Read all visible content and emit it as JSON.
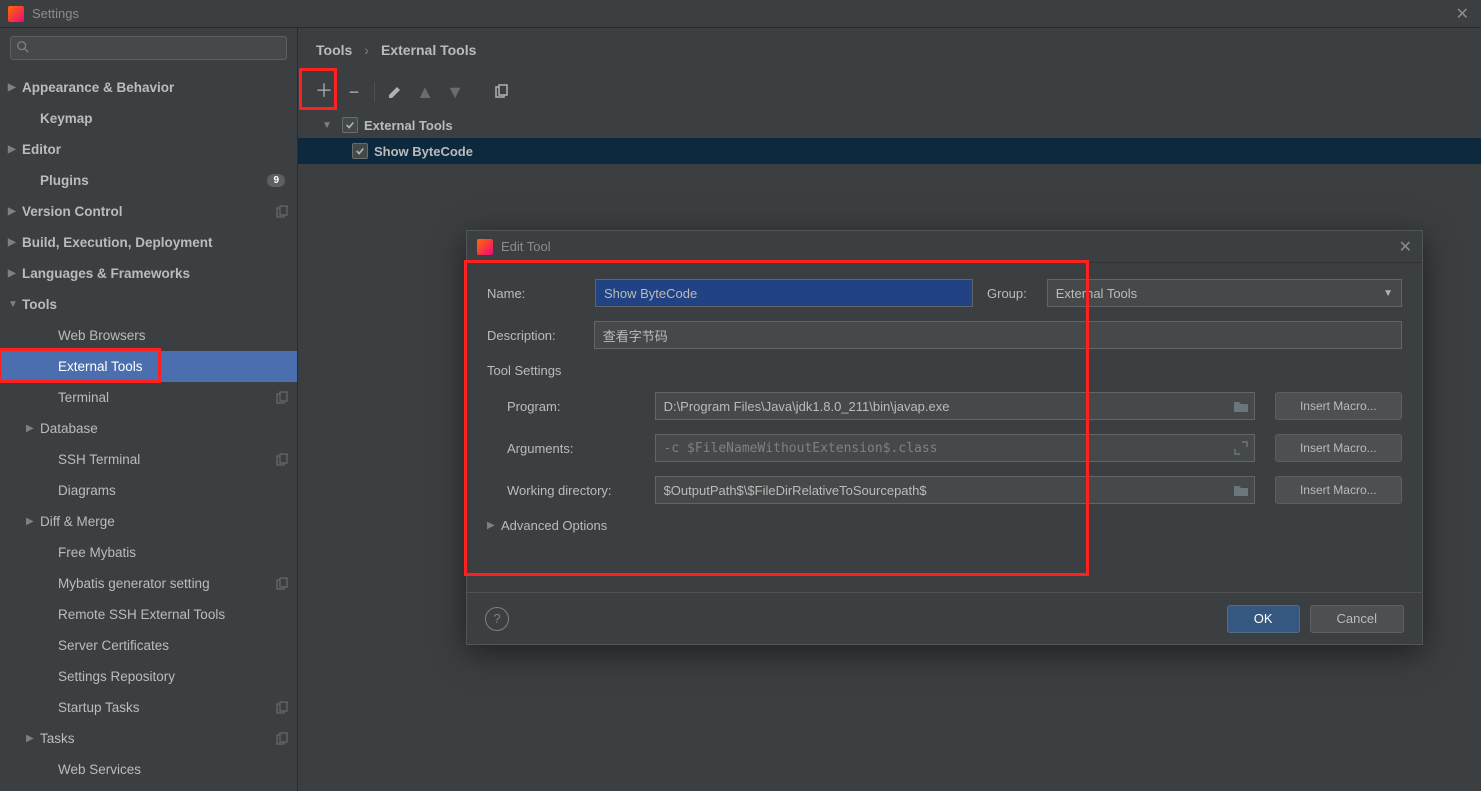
{
  "window": {
    "title": "Settings"
  },
  "search": {
    "placeholder": ""
  },
  "sidebar": {
    "items": [
      {
        "label": "Appearance & Behavior",
        "bold": true,
        "arrow": "collapsed",
        "level": 1
      },
      {
        "label": "Keymap",
        "bold": true,
        "level": 2
      },
      {
        "label": "Editor",
        "bold": true,
        "arrow": "collapsed",
        "level": 1
      },
      {
        "label": "Plugins",
        "bold": true,
        "level": 2,
        "badge": "9"
      },
      {
        "label": "Version Control",
        "bold": true,
        "arrow": "collapsed",
        "level": 1,
        "copy": true
      },
      {
        "label": "Build, Execution, Deployment",
        "bold": true,
        "arrow": "collapsed",
        "level": 1
      },
      {
        "label": "Languages & Frameworks",
        "bold": true,
        "arrow": "collapsed",
        "level": 1
      },
      {
        "label": "Tools",
        "bold": true,
        "arrow": "expanded",
        "level": 1
      },
      {
        "label": "Web Browsers",
        "level": 3
      },
      {
        "label": "External Tools",
        "level": 3,
        "selected": true
      },
      {
        "label": "Terminal",
        "level": 3,
        "copy": true
      },
      {
        "label": "Database",
        "arrow": "collapsed",
        "level": 2
      },
      {
        "label": "SSH Terminal",
        "level": 3,
        "copy": true
      },
      {
        "label": "Diagrams",
        "level": 3
      },
      {
        "label": "Diff & Merge",
        "arrow": "collapsed",
        "level": 2
      },
      {
        "label": "Free Mybatis",
        "level": 3
      },
      {
        "label": "Mybatis generator setting",
        "level": 3,
        "copy": true
      },
      {
        "label": "Remote SSH External Tools",
        "level": 3
      },
      {
        "label": "Server Certificates",
        "level": 3
      },
      {
        "label": "Settings Repository",
        "level": 3
      },
      {
        "label": "Startup Tasks",
        "level": 3,
        "copy": true
      },
      {
        "label": "Tasks",
        "arrow": "collapsed",
        "level": 2,
        "copy": true
      },
      {
        "label": "Web Services",
        "level": 3
      }
    ]
  },
  "breadcrumb": {
    "a": "Tools",
    "b": "External Tools"
  },
  "tools_tree": {
    "group": "External Tools",
    "item": "Show ByteCode"
  },
  "dialog": {
    "title": "Edit Tool",
    "labels": {
      "name": "Name:",
      "group": "Group:",
      "description": "Description:",
      "section": "Tool Settings",
      "program": "Program:",
      "arguments": "Arguments:",
      "wd": "Working directory:",
      "advanced": "Advanced Options",
      "insert": "Insert Macro..."
    },
    "values": {
      "name": "Show ByteCode",
      "group": "External Tools",
      "description": "查看字节码",
      "program": "D:\\Program Files\\Java\\jdk1.8.0_211\\bin\\javap.exe",
      "arguments": "-c $FileNameWithoutExtension$.class",
      "wd": "$OutputPath$\\$FileDirRelativeToSourcepath$"
    },
    "buttons": {
      "ok": "OK",
      "cancel": "Cancel"
    }
  }
}
